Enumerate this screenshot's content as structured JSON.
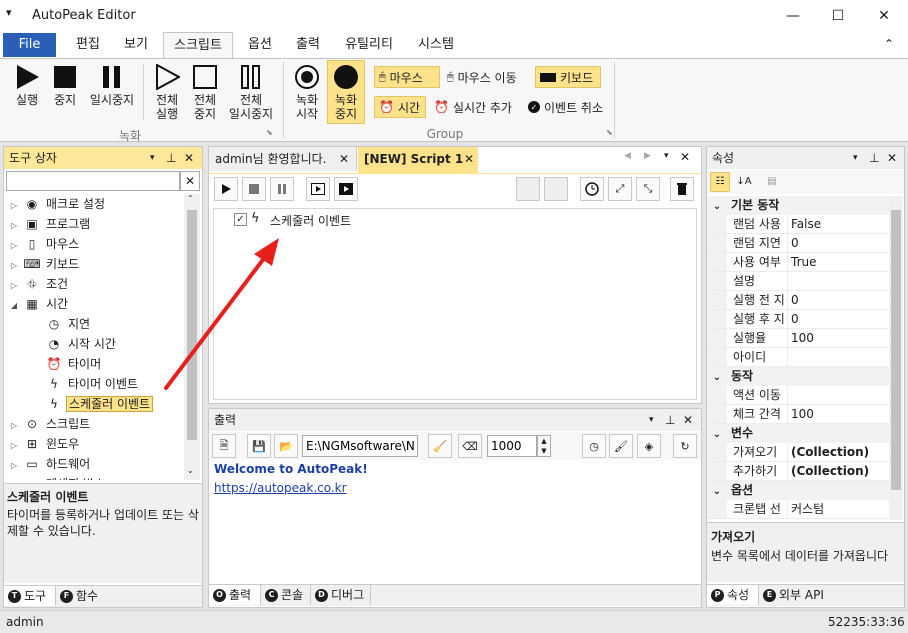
{
  "title_bar": {
    "app_title": "AutoPeak Editor",
    "minimize": "—",
    "maximize": "☐",
    "close": "✕",
    "sys_menu": "▾"
  },
  "menu": {
    "file": "File",
    "items": [
      "편집",
      "보기",
      "스크립트",
      "옵션",
      "출력",
      "유틸리티",
      "시스템"
    ],
    "active": "스크립트",
    "collapse": "⌃"
  },
  "ribbon": {
    "record_group": {
      "label": "녹화",
      "buttons": [
        "실행",
        "중지",
        "일시중지",
        "전체\n실행",
        "전체\n중지",
        "전체\n일시중지"
      ]
    },
    "group2": {
      "label": "Group",
      "rec_start": "녹화\n시작",
      "rec_stop": "녹화\n중지",
      "mouse": "마우스",
      "mouse_move": "마우스 이동",
      "keyboard": "키보드",
      "time": "시간",
      "realtime_add": "실시간 추가",
      "event_cancel": "이벤트 취소"
    }
  },
  "toolbox": {
    "title": "도구 상자",
    "search_value": "",
    "clear": "✕",
    "tree": [
      {
        "label": "매크로 설정",
        "icon": "globe-icon",
        "level": 0,
        "expander": "▷"
      },
      {
        "label": "프로그램",
        "icon": "program-icon",
        "level": 0,
        "expander": "▷"
      },
      {
        "label": "마우스",
        "icon": "mouse-icon",
        "level": 0,
        "expander": "▷"
      },
      {
        "label": "키보드",
        "icon": "keyboard-icon",
        "level": 0,
        "expander": "▷"
      },
      {
        "label": "조건",
        "icon": "condition-icon",
        "level": 0,
        "expander": "▷"
      },
      {
        "label": "시간",
        "icon": "calendar-icon",
        "level": 0,
        "expander": "◢"
      },
      {
        "label": "지연",
        "icon": "stopwatch-icon",
        "level": 1,
        "expander": ""
      },
      {
        "label": "시작 시간",
        "icon": "clock24-icon",
        "level": 1,
        "expander": ""
      },
      {
        "label": "타이머",
        "icon": "alarm-icon",
        "level": 1,
        "expander": ""
      },
      {
        "label": "타이머 이벤트",
        "icon": "lightning-icon",
        "level": 1,
        "expander": ""
      },
      {
        "label": "스케줄러 이벤트",
        "icon": "lightning-icon",
        "level": 1,
        "expander": "",
        "selected": true
      },
      {
        "label": "스크립트",
        "icon": "script-icon",
        "level": 0,
        "expander": "▷"
      },
      {
        "label": "윈도우",
        "icon": "windows-icon",
        "level": 0,
        "expander": "▷"
      },
      {
        "label": "하드웨어",
        "icon": "laptop-icon",
        "level": 0,
        "expander": "▷"
      },
      {
        "label": "메세지 박스",
        "icon": "message-icon",
        "level": 0,
        "expander": "▷"
      }
    ],
    "desc_title": "스케줄러 이벤트",
    "desc_text": "타이머를 등록하거나 업데이트 또는 삭제할 수 있습니다.",
    "tabs": [
      {
        "badge": "T",
        "label": "도구"
      },
      {
        "badge": "F",
        "label": "함수"
      }
    ]
  },
  "editor": {
    "tabs": [
      {
        "label": "admin님 환영합니다.",
        "close": "✕"
      },
      {
        "label": "[NEW] Script 1",
        "close": "✕"
      }
    ],
    "nav": [
      "◀",
      "▶",
      "▾",
      "✕"
    ],
    "script_item": "스케줄러 이벤트"
  },
  "output": {
    "title": "출력",
    "path_value": "E:\\NGMsoftware\\NG",
    "number_value": "1000",
    "welcome": "Welcome to AutoPeak!",
    "link": "https://autopeak.co.kr",
    "tabs": [
      {
        "badge": "O",
        "label": "출력"
      },
      {
        "badge": "C",
        "label": "콘솔"
      },
      {
        "badge": "D",
        "label": "디버그"
      }
    ]
  },
  "properties": {
    "title": "속성",
    "sections": [
      {
        "name": "기본 동작",
        "rows": [
          [
            "랜덤 사용",
            "False"
          ],
          [
            "랜덤 지연",
            "0"
          ],
          [
            "사용 여부",
            "True"
          ],
          [
            "설명",
            ""
          ],
          [
            "실행 전 지",
            "0"
          ],
          [
            "실행 후 지",
            "0"
          ],
          [
            "실행율",
            "100"
          ],
          [
            "아이디",
            ""
          ]
        ]
      },
      {
        "name": "동작",
        "rows": [
          [
            "액션 이동",
            ""
          ],
          [
            "체크 간격",
            "100"
          ]
        ]
      },
      {
        "name": "변수",
        "rows": [
          [
            "가져오기",
            "(Collection)"
          ],
          [
            "추가하기",
            "(Collection)"
          ]
        ]
      },
      {
        "name": "옵션",
        "rows": [
          [
            "크론탭 선",
            "커스텀"
          ]
        ]
      }
    ],
    "desc_title": "가져오기",
    "desc_text": "변수 목록에서 데이터를 가져옵니다",
    "tabs": [
      {
        "badge": "P",
        "label": "속성"
      },
      {
        "badge": "E",
        "label": "외부 API"
      }
    ]
  },
  "status": {
    "user": "admin",
    "time": "52235:33:36"
  },
  "colors": {
    "accent": "#2b5eb6",
    "highlight": "#fde28c",
    "arrow": "#e8201c"
  }
}
